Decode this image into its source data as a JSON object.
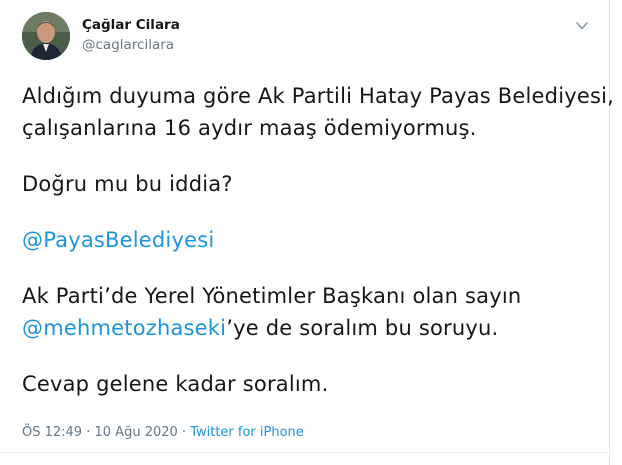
{
  "author": {
    "display_name": "Çağlar Cilara",
    "handle": "@caglarcilara"
  },
  "tweet": {
    "p1_line1": "Aldığım duyuma göre Ak Partili Hatay Payas Belediyesi,",
    "p1_line2": "çalışanlarına 16 aydır maaş ödemiyormuş.",
    "p2": "Doğru mu bu iddia?",
    "mention_payas": "@PayasBelediyesi",
    "p4_line1": "Ak Parti’de Yerel Yönetimler Başkanı olan sayın",
    "mention_mehmet": "@mehmetozhaseki",
    "p4_line2_suffix": "’ye de soralım bu soruyu.",
    "p5": "Cevap gelene kadar soralım."
  },
  "meta": {
    "time": "ÖS 12:49",
    "separator1": " · ",
    "date": "10 Ağu 2020",
    "separator2": " · ",
    "source": "Twitter for iPhone"
  },
  "colors": {
    "link": "#1b95e0",
    "secondary_text": "#657786",
    "primary_text": "#14171a"
  },
  "icons": {
    "menu": "chevron-down-icon"
  }
}
